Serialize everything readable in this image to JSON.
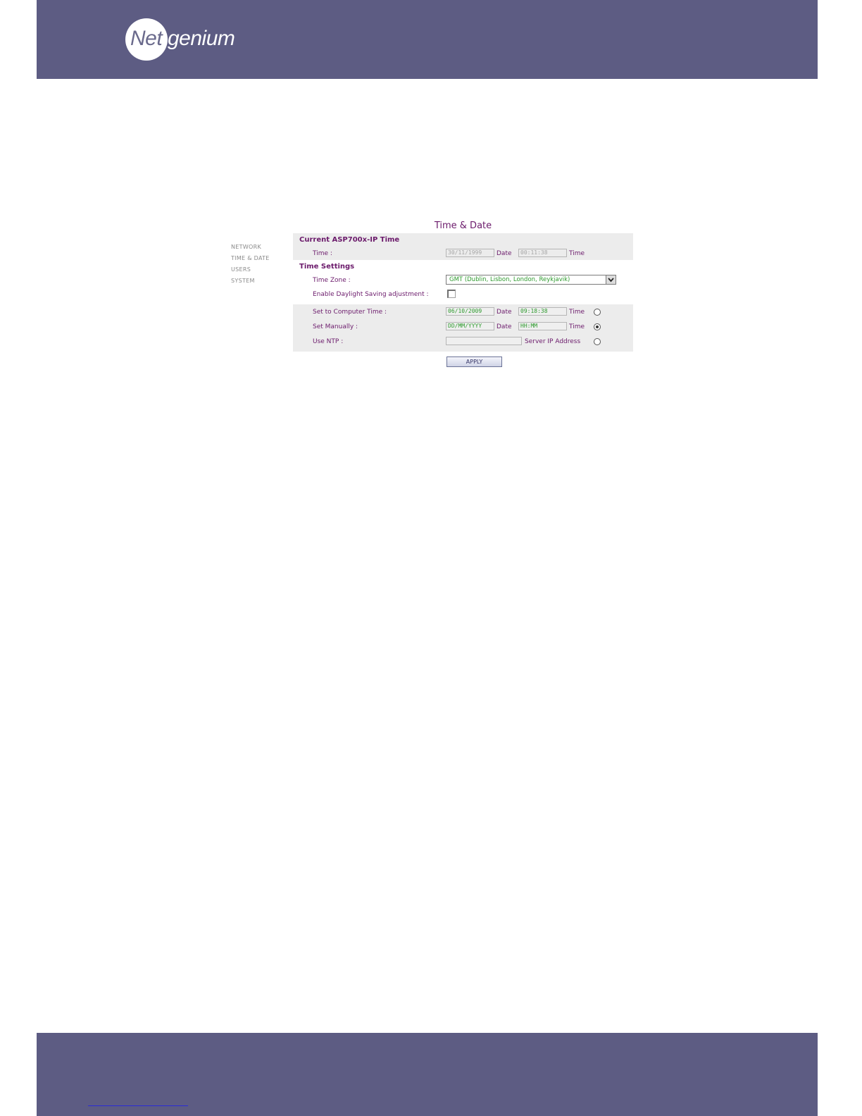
{
  "brand": {
    "logo_part_1": "Net",
    "logo_part_2": "genium"
  },
  "nav": {
    "items": [
      {
        "label": "NETWORK"
      },
      {
        "label": "TIME & DATE"
      },
      {
        "label": "USERS"
      },
      {
        "label": "SYSTEM"
      }
    ]
  },
  "page": {
    "title": "Time & Date"
  },
  "current": {
    "title": "Current ASP700x-IP Time",
    "time_label": "Time :",
    "date_value": "30/11/1999",
    "date_unit": "Date",
    "time_value": "00:11:38",
    "time_unit": "Time"
  },
  "settings": {
    "title": "Time Settings",
    "timezone_label": "Time Zone :",
    "timezone_value": "GMT (Dublin, Lisbon, London, Reykjavik)",
    "dst_label": "Enable Daylight Saving adjustment :",
    "dst_checked": false,
    "computer": {
      "label": "Set to Computer Time :",
      "date_value": "06/10/2009",
      "date_unit": "Date",
      "time_value": "09:18:38",
      "time_unit": "Time",
      "selected": false
    },
    "manual": {
      "label": "Set Manually :",
      "date_value": "DD/MM/YYYY",
      "date_unit": "Date",
      "time_value": "HH:MM",
      "time_unit": "Time",
      "selected": true
    },
    "ntp": {
      "label": "Use NTP :",
      "server_value": "",
      "server_unit": "Server IP Address",
      "selected": false
    }
  },
  "apply_label": "APPLY",
  "colors": {
    "band": "#5d5c83",
    "label": "#6b1a6b",
    "value_green": "#2e9a2e",
    "panel": "#ececec"
  }
}
